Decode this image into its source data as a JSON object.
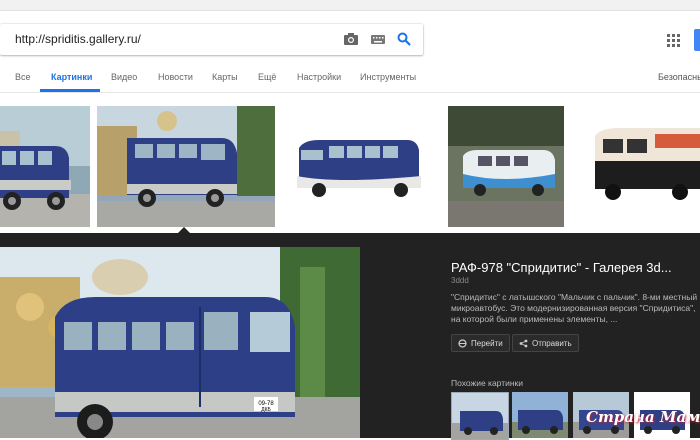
{
  "search": {
    "query": "http://spriditis.gallery.ru/"
  },
  "tabs": [
    {
      "label": "Все"
    },
    {
      "label": "Картинки"
    },
    {
      "label": "Видео"
    },
    {
      "label": "Новости"
    },
    {
      "label": "Карты"
    },
    {
      "label": "Ещё"
    },
    {
      "label": "Настройки"
    },
    {
      "label": "Инструменты"
    }
  ],
  "safe_search": "Безопасны",
  "preview": {
    "title": "РАФ-978 \"Спридитис\" - Галерея 3d...",
    "source": "3ddd",
    "description": "\"Спридитис\" с латышского \"Мальчик с пальчик\". 8-ми местный микроавтобус. Это модернизированная версия \"Спридитиса\", на которой были применены элементы, ...",
    "visit_label": "Перейти",
    "share_label": "Отправить",
    "plate": "09-78",
    "plate2": "ДКБ"
  },
  "similar": {
    "label": "Похожие картинки"
  },
  "watermark": "Страна Мам",
  "colors": {
    "accent": "#1a73e8",
    "van_blue": "#2c3e7a",
    "dark_panel": "#222222"
  },
  "icons": [
    "camera-icon",
    "keyboard-icon",
    "search-icon",
    "apps-icon",
    "link-icon",
    "share-icon"
  ]
}
